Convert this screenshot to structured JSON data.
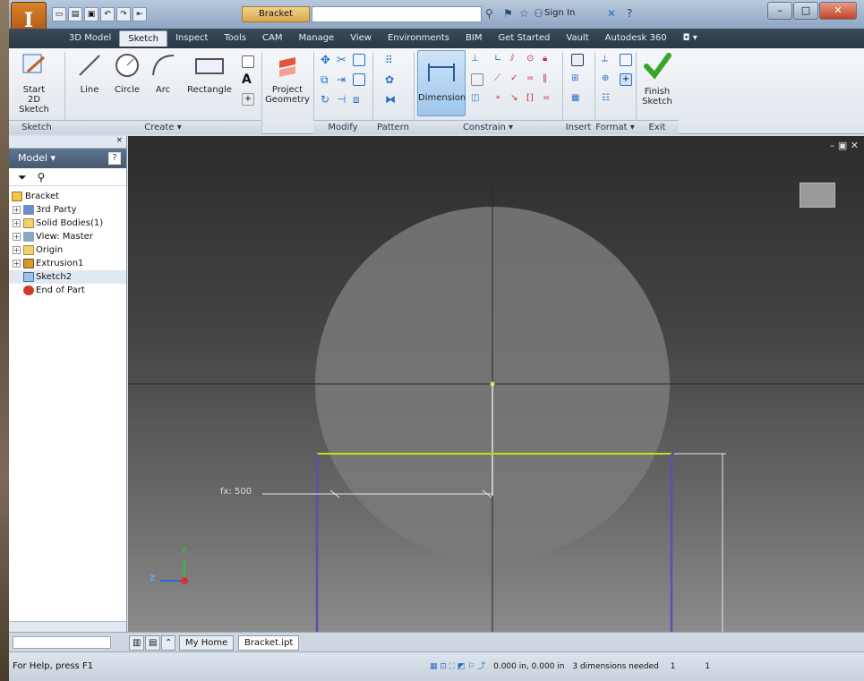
{
  "titlebar": {
    "document_title": "Bracket",
    "sign_in": "Sign In",
    "minimize": "–",
    "maximize": "□",
    "close": "✕"
  },
  "menu": {
    "tabs": [
      "3D Model",
      "Sketch",
      "Inspect",
      "Tools",
      "CAM",
      "Manage",
      "View",
      "Environments",
      "BIM",
      "Get Started",
      "Vault",
      "Autodesk 360"
    ],
    "active": "Sketch"
  },
  "ribbon": {
    "start_sketch": "Start",
    "start_sketch_2": "2D Sketch",
    "line": "Line",
    "circle": "Circle",
    "arc": "Arc",
    "rectangle": "Rectangle",
    "project": "Project",
    "geometry": "Geometry",
    "dimension": "Dimension",
    "finish": "Finish",
    "finish_2": "Sketch",
    "panels": {
      "sketch": "Sketch",
      "create": "Create ▾",
      "modify": "Modify",
      "pattern": "Pattern",
      "constrain": "Constrain ▾",
      "insert": "Insert",
      "format": "Format ▾",
      "exit": "Exit"
    }
  },
  "browser": {
    "title": "Model ▾",
    "items": [
      "Bracket",
      "3rd Party",
      "Solid Bodies(1)",
      "View: Master",
      "Origin",
      "Extrusion1",
      "Sketch2",
      "End of Part"
    ]
  },
  "viewport": {
    "dimension_text": "fx: 500",
    "axis_y": "Y",
    "axis_z": "Z"
  },
  "doc_tabs": {
    "home": "My Home",
    "file": "Bracket.ipt"
  },
  "status": {
    "help": "For Help, press F1",
    "coords": "0.000 in, 0.000 in",
    "dims_needed": "3 dimensions needed",
    "count_a": "1",
    "count_b": "1"
  },
  "colors": {
    "accent_green": "#b5e61d",
    "sketch_line_purple": "#5b4fb0",
    "circle_fill": "#7a7a7a",
    "finish_check": "#3aa52b"
  }
}
